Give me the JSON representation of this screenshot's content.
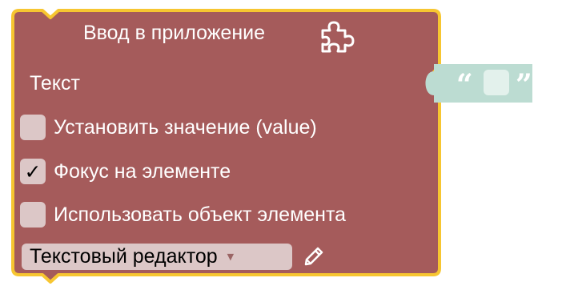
{
  "block": {
    "title": "Ввод в приложение",
    "input_label": "Текст",
    "colors": {
      "fill": "#a55b5b",
      "outline": "#f7c631",
      "field": "#dcc7c7",
      "text_block": "#bcdcd2",
      "text_field": "#e3f1ec"
    },
    "options": [
      {
        "label": "Установить значение (value)",
        "checked": false,
        "mark": ""
      },
      {
        "label": "Фокус на элементе",
        "checked": true,
        "mark": "✓"
      },
      {
        "label": "Использовать объект элемента",
        "checked": false,
        "mark": ""
      }
    ],
    "dropdown": {
      "value": "Текстовый редактор",
      "arrow": "▼"
    },
    "icons": {
      "header": "puzzle-icon",
      "edit": "pencil-icon"
    }
  },
  "text_block": {
    "open_quote": "“",
    "close_quote": "”",
    "value": ""
  }
}
